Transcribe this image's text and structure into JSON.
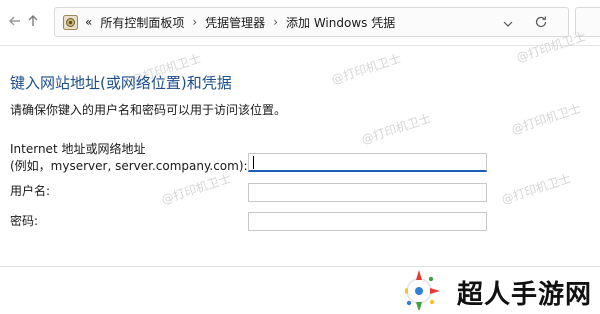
{
  "nav": {
    "back_icon": "arrow-left-icon",
    "up_icon": "arrow-up-icon"
  },
  "address_bar": {
    "overflow_glyph": "«",
    "crumbs": [
      "所有控制面板项",
      "凭据管理器",
      "添加 Windows 凭据"
    ],
    "separator": "›"
  },
  "page": {
    "heading": "键入网站地址(或网络位置)和凭据",
    "subtext": "请确保你键入的用户名和密码可以用于访问该位置。"
  },
  "form": {
    "address_label_line1": "Internet 地址或网络地址",
    "address_label_line2": "(例如，myserver, server.company.com):",
    "address_value": "",
    "username_label": "用户名:",
    "username_value": "",
    "password_label": "密码:",
    "password_value": ""
  },
  "watermark": "@打印机卫士",
  "brand": {
    "text": "超人手游网"
  },
  "colors": {
    "heading": "#1e4e8c",
    "focus_underline": "#1a5fb4"
  }
}
